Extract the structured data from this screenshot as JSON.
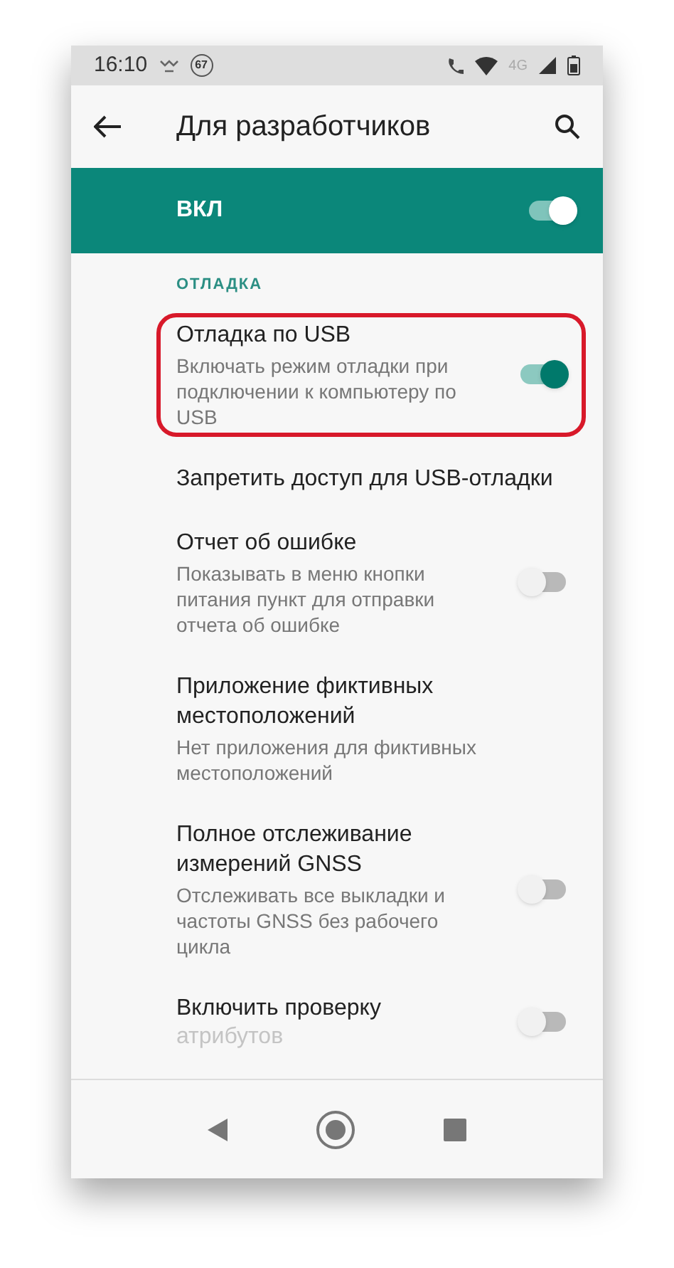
{
  "status_bar": {
    "time": "16:10",
    "badge": "67",
    "network_label": "4G"
  },
  "toolbar": {
    "title": "Для разработчиков"
  },
  "master_switch": {
    "label": "ВКЛ",
    "on": true
  },
  "section": {
    "title": "ОТЛАДКА"
  },
  "items": [
    {
      "kind": "switch",
      "title": "Отладка по USB",
      "summary": "Включать режим отладки при подключении к компьютеру по USB",
      "on": true,
      "highlighted": true
    },
    {
      "kind": "plain",
      "title": "Запретить доступ для USB-отладки",
      "highlighted": false
    },
    {
      "kind": "switch",
      "title": "Отчет об ошибке",
      "summary": "Показывать в меню кнопки питания пункт для отправки отчета об ошибке",
      "on": false,
      "highlighted": false
    },
    {
      "kind": "plain",
      "title": "Приложение фиктивных местоположений",
      "summary": "Нет приложения для фиктивных местоположений",
      "highlighted": false
    },
    {
      "kind": "switch",
      "title": "Полное отслеживание измерений GNSS",
      "summary": "Отслеживать все выкладки и частоты GNSS без рабочего цикла",
      "on": false,
      "highlighted": false
    },
    {
      "kind": "switch",
      "title": "Включить проверку",
      "title_faded": "атрибутов",
      "on": false,
      "highlighted": false
    }
  ]
}
